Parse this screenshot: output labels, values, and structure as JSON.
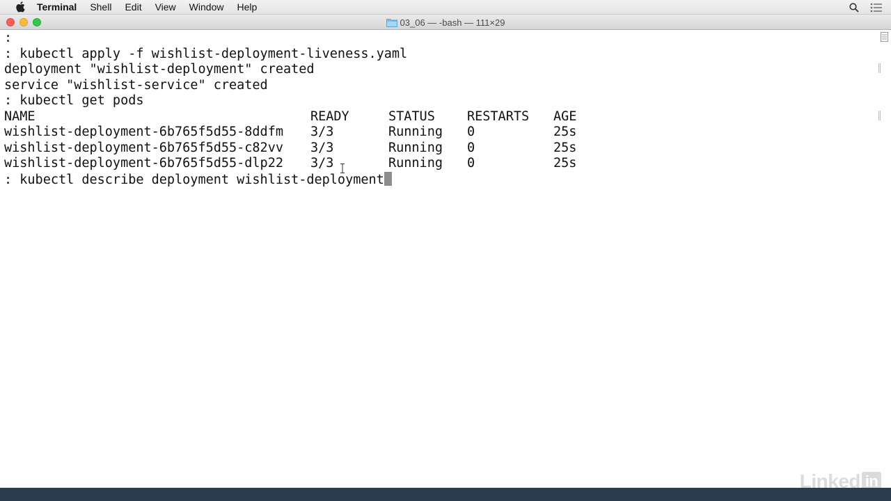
{
  "menubar": {
    "app_name": "Terminal",
    "items": [
      "Shell",
      "Edit",
      "View",
      "Window",
      "Help"
    ]
  },
  "window": {
    "title": "03_06 — -bash — 111×29"
  },
  "terminal": {
    "lines_before": [
      ":",
      ": kubectl apply -f wishlist-deployment-liveness.yaml",
      "deployment \"wishlist-deployment\" created",
      "service \"wishlist-service\" created",
      ": kubectl get pods"
    ],
    "pods_table": {
      "headers": [
        "NAME",
        "READY",
        "STATUS",
        "RESTARTS",
        "AGE"
      ],
      "rows": [
        [
          "wishlist-deployment-6b765f5d55-8ddfm",
          "3/3",
          "Running",
          "0",
          "25s"
        ],
        [
          "wishlist-deployment-6b765f5d55-c82vv",
          "3/3",
          "Running",
          "0",
          "25s"
        ],
        [
          "wishlist-deployment-6b765f5d55-dlp22",
          "3/3",
          "Running",
          "0",
          "25s"
        ]
      ]
    },
    "current_command": ": kubectl describe deployment wishlist-deployment"
  },
  "watermark": {
    "brand": "Linked",
    "box": "in"
  },
  "colors": {
    "close": "#fc605b",
    "minimize": "#fdbc40",
    "maximize": "#34c84a",
    "desktop": "#2b3a48"
  },
  "icons": {
    "apple": "apple-icon",
    "search": "spotlight-search-icon",
    "notifications": "notification-center-icon",
    "folder": "folder-icon"
  }
}
